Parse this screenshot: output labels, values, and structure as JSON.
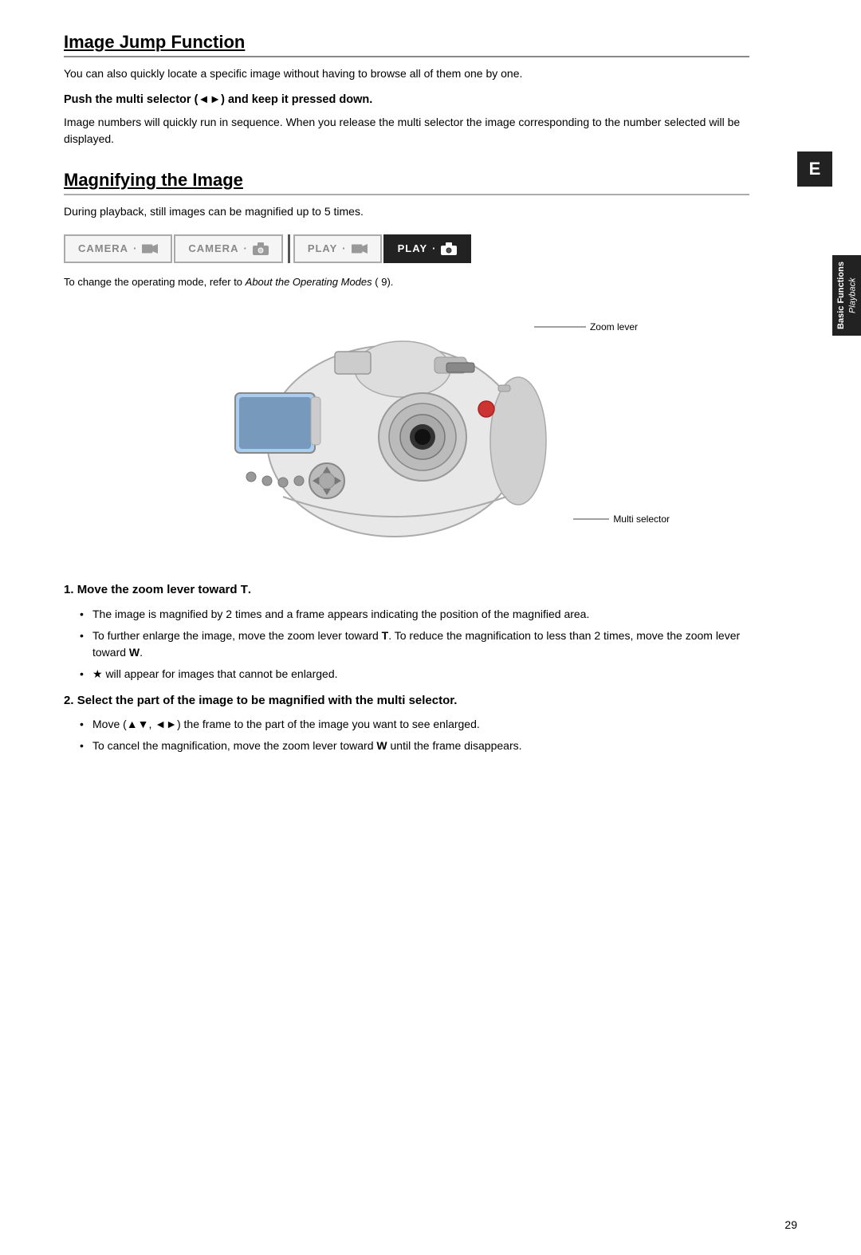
{
  "page": {
    "number": "29"
  },
  "side_tab": {
    "line1": "Basic Functions",
    "line2": "Playback"
  },
  "e_label": "E",
  "section1": {
    "title": "Image Jump Function",
    "intro": "You can also quickly locate a specific image without having to browse all of them one by one.",
    "instruction_bold": "Push the multi selector (◄►) and keep it pressed down.",
    "instruction_detail": "Image numbers will quickly run in sequence. When you release the multi selector the image corresponding to the number selected will be displayed."
  },
  "section2": {
    "title": "Magnifying the Image",
    "intro": "During playback, still images can be magnified up to 5 times.",
    "mode_buttons": [
      {
        "label": "CAMERA",
        "icon": "video",
        "active": false
      },
      {
        "label": "CAMERA",
        "icon": "camera",
        "active": false
      },
      {
        "label": "PLAY",
        "icon": "video",
        "active": false
      },
      {
        "label": "PLAY",
        "icon": "camera",
        "active": true
      }
    ],
    "reference_line": "To change the operating mode, refer to ",
    "reference_italic": "About the Operating Modes",
    "reference_end": " (  9).",
    "diagram_labels": {
      "zoom_lever": "Zoom lever",
      "multi_selector": "Multi selector"
    }
  },
  "numbered_items": [
    {
      "number": "1",
      "title": "Move the zoom lever toward T.",
      "bullets": [
        "The image is magnified by 2 times and a frame appears indicating the position of the magnified area.",
        "To further enlarge the image, move the zoom lever toward T. To reduce the magnification to less than 2 times, move the zoom lever toward W.",
        "★ will appear for images that cannot be enlarged."
      ]
    },
    {
      "number": "2",
      "title": "Select the part of the image to be magnified with the multi selector.",
      "bullets": [
        "Move (▲▼, ◄►) the frame to the part of the image you want to see enlarged.",
        "To cancel the magnification, move the zoom lever toward W until the frame disappears."
      ]
    }
  ]
}
